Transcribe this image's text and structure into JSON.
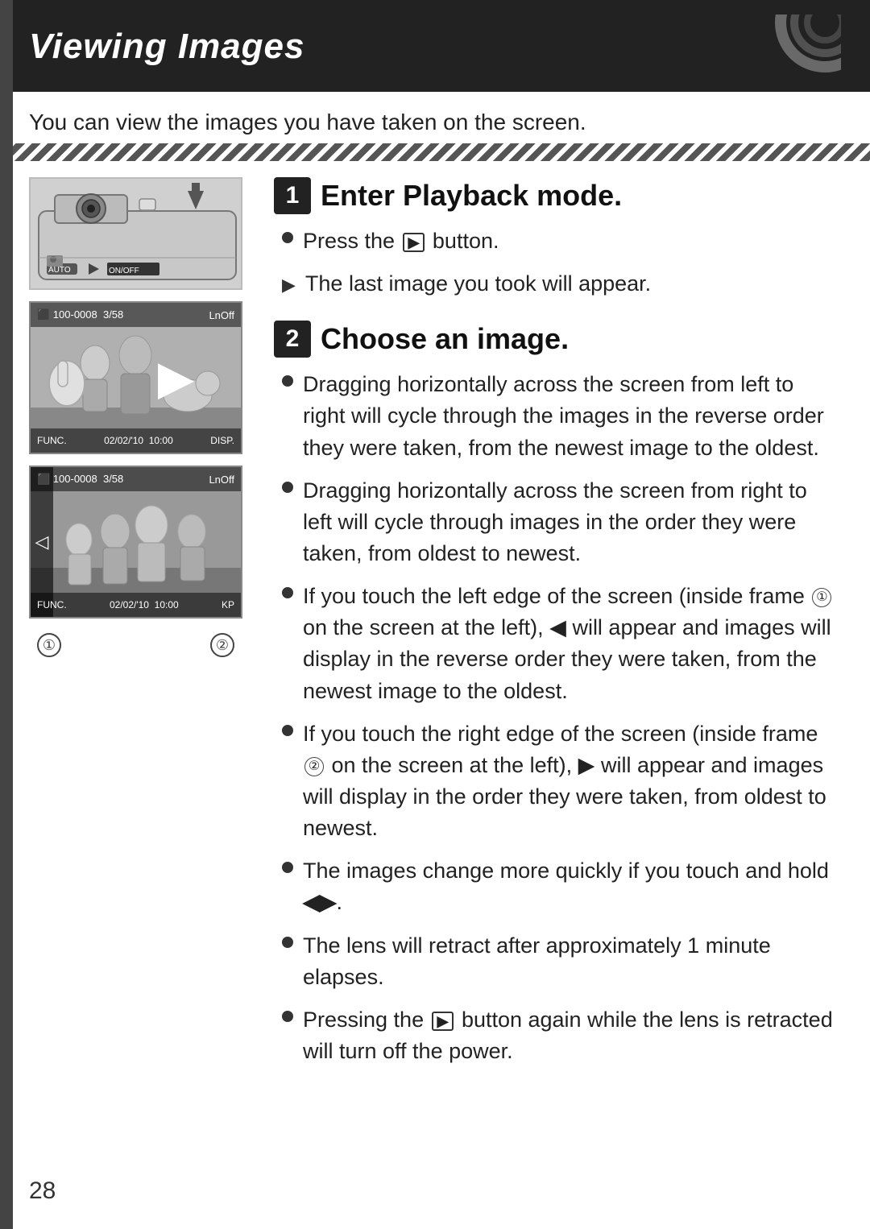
{
  "page": {
    "title": "Viewing Images",
    "intro": "You can view the images you have taken on the screen.",
    "page_number": "28"
  },
  "steps": [
    {
      "number": "1",
      "title": "Enter Playback mode.",
      "bullets": [
        {
          "type": "dot",
          "text": "Press the",
          "has_icon": true,
          "icon": "▶",
          "text_after": "button."
        },
        {
          "type": "arrow",
          "text": "The last image you took will appear."
        }
      ]
    },
    {
      "number": "2",
      "title": "Choose an image.",
      "bullets": [
        {
          "type": "dot",
          "text": "Dragging horizontally across the screen from left to right will cycle through the images in the reverse order they were taken, from the newest image to the oldest."
        },
        {
          "type": "dot",
          "text": "Dragging horizontally across the screen from right to left will cycle through images in the order they were taken, from oldest to newest."
        },
        {
          "type": "dot",
          "text_parts": [
            "If you touch the left edge of the screen (inside frame ",
            "①",
            " on the screen at the left), ◀ will appear and images will display in the reverse order they were taken, from the newest image to the oldest."
          ]
        },
        {
          "type": "dot",
          "text_parts": [
            "If you touch the right edge of the screen (inside frame ",
            "②",
            " on the screen at the left), ▶ will appear and images will display in the order they were taken, from oldest to newest."
          ]
        },
        {
          "type": "dot",
          "text": "The images change more quickly if you touch and hold ◀▶."
        },
        {
          "type": "dot",
          "text": "The lens will retract after approximately 1 minute elapses."
        },
        {
          "type": "dot",
          "text_parts": [
            "Pressing the ",
            "▶",
            " button again while the lens is retracted will turn off the power."
          ],
          "has_inline_icon": true
        }
      ]
    }
  ],
  "images": {
    "screen1_top_info": "100-0008  3/58  LnOff",
    "screen1_bottom_info": "02/02/'10  10:00  DISP.",
    "screen2_top_info": "100-0008  3/58  LnOff",
    "screen2_bottom_info": "02/02/'10  10:00  KP",
    "label1": "①",
    "label2": "②"
  }
}
